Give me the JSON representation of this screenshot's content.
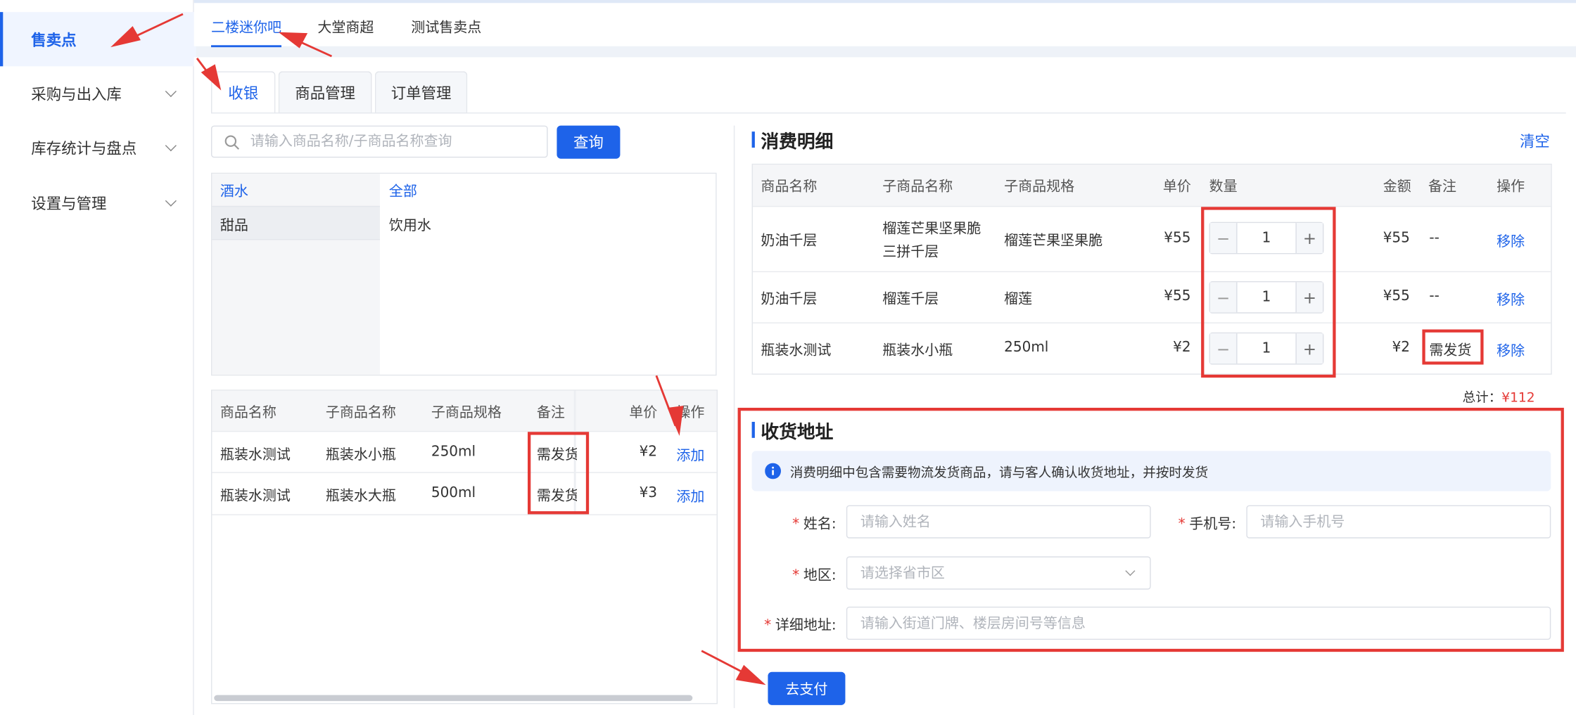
{
  "sidebar": {
    "items": [
      {
        "label": "售卖点"
      },
      {
        "label": "采购与出入库"
      },
      {
        "label": "库存统计与盘点"
      },
      {
        "label": "设置与管理"
      }
    ]
  },
  "top_tabs": [
    "二楼迷你吧",
    "大堂商超",
    "测试售卖点"
  ],
  "sub_tabs": [
    "收银",
    "商品管理",
    "订单管理"
  ],
  "search": {
    "placeholder": "请输入商品名称/子商品名称查询",
    "button": "查询"
  },
  "categories": {
    "left": [
      "酒水",
      "甜品"
    ],
    "right": [
      "全部",
      "饮用水"
    ]
  },
  "product_table": {
    "headers": [
      "商品名称",
      "子商品名称",
      "子商品规格",
      "备注",
      "单价",
      "操作"
    ],
    "rows": [
      {
        "name": "瓶装水测试",
        "sub": "瓶装水小瓶",
        "spec": "250ml",
        "note": "需发货",
        "price": "¥2",
        "action": "添加"
      },
      {
        "name": "瓶装水测试",
        "sub": "瓶装水大瓶",
        "spec": "500ml",
        "note": "需发货",
        "price": "¥3",
        "action": "添加"
      }
    ]
  },
  "detail": {
    "title": "消费明细",
    "clear": "清空",
    "headers": [
      "商品名称",
      "子商品名称",
      "子商品规格",
      "单价",
      "数量",
      "金额",
      "备注",
      "操作"
    ],
    "rows": [
      {
        "name": "奶油千层",
        "sub_line1": "榴莲芒果坚果脆",
        "sub_line2": "三拼千层",
        "spec": "榴莲芒果坚果脆",
        "price": "¥55",
        "qty": "1",
        "amount": "¥55",
        "note": "--",
        "action": "移除"
      },
      {
        "name": "奶油千层",
        "sub_line1": "榴莲千层",
        "sub_line2": "",
        "spec": "榴莲",
        "price": "¥55",
        "qty": "1",
        "amount": "¥55",
        "note": "--",
        "action": "移除"
      },
      {
        "name": "瓶装水测试",
        "sub_line1": "瓶装水小瓶",
        "sub_line2": "",
        "spec": "250ml",
        "price": "¥2",
        "qty": "1",
        "amount": "¥2",
        "note": "需发货",
        "action": "移除"
      }
    ],
    "total_label": "总计：",
    "total_value": "¥112",
    "minus": "−",
    "plus": "+"
  },
  "address": {
    "title": "收货地址",
    "notice": "消费明细中包含需要物流发货商品，请与客人确认收货地址，并按时发货",
    "name_label": "姓名:",
    "name_placeholder": "请输入姓名",
    "phone_label": "手机号:",
    "phone_placeholder": "请输入手机号",
    "region_label": "地区:",
    "region_placeholder": "请选择省市区",
    "detail_label": "详细地址:",
    "detail_placeholder": "请输入街道门牌、楼层房间号等信息",
    "required_mark": "*"
  },
  "pay_button": "去支付",
  "colors": {
    "accent": "#1e63e9",
    "annotation": "#e53935",
    "total": "#e53935"
  }
}
